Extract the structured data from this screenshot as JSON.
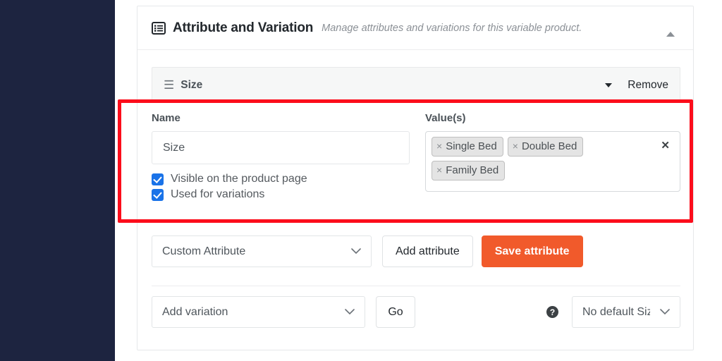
{
  "header": {
    "icon": "list-view-icon",
    "title": "Attribute and Variation",
    "subtitle": "Manage attributes and variations for this variable product.",
    "collapse_icon": "caret-up-icon"
  },
  "attribute_bar": {
    "grip_icon": "hamburger-grip-icon",
    "name": "Size",
    "expand_icon": "caret-down-icon",
    "remove_label": "Remove"
  },
  "form": {
    "name_label": "Name",
    "name_value": "Size",
    "name_placeholder": "",
    "values_label": "Value(s)",
    "tags": [
      {
        "remove_icon": "×",
        "label": "Single Bed"
      },
      {
        "remove_icon": "×",
        "label": "Double Bed"
      },
      {
        "remove_icon": "×",
        "label": "Family Bed"
      }
    ],
    "clear_all_icon": "✕",
    "checkboxes": [
      {
        "label": "Visible on the product page",
        "checked": true
      },
      {
        "label": "Used for variations",
        "checked": true
      }
    ]
  },
  "actions": {
    "attribute_type_selected": "Custom Attribute",
    "add_attribute_label": "Add attribute",
    "save_attribute_label": "Save attribute"
  },
  "variation": {
    "add_variation_selected": "Add variation",
    "go_label": "Go",
    "help_icon": "question-mark-icon",
    "default_size_selected": "No default Size"
  },
  "colors": {
    "sidebar": "#1d2440",
    "primary_button": "#f15a2b",
    "checkbox": "#1a73e8",
    "highlight_border": "#fc0d1b"
  }
}
